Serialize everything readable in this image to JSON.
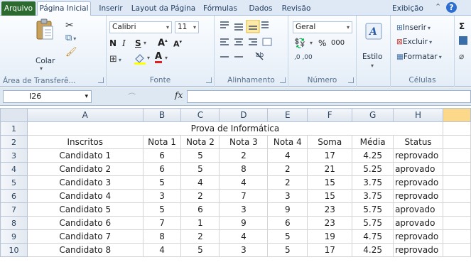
{
  "tabs": {
    "file": "Arquivo",
    "home": "Página Inicial",
    "insert": "Inserir",
    "layout": "Layout da Página",
    "formulas": "Fórmulas",
    "data": "Dados",
    "review": "Revisão",
    "view": "Exibição"
  },
  "ribbon": {
    "clipboard": {
      "paste": "Colar",
      "label": "Área de Transferê..."
    },
    "font": {
      "name": "Calibri",
      "size": "11",
      "bold": "N",
      "italic": "I",
      "underline": "S",
      "grow": "A",
      "shrink": "A",
      "color_letter": "A",
      "label": "Fonte"
    },
    "alignment": {
      "label": "Alinhamento"
    },
    "number": {
      "format": "Geral",
      "percent": "%",
      "thousands": "000",
      "inc_dec": ",0 ,00",
      "label": "Número"
    },
    "styles": {
      "button": "Estilo"
    },
    "cells": {
      "insert": "Inserir",
      "delete": "Excluir",
      "format": "Formatar",
      "label": "Células"
    },
    "sigma": "Σ"
  },
  "formula_bar": {
    "cell_ref": "I26",
    "fx": "fx",
    "content": ""
  },
  "sheet": {
    "columns": [
      "A",
      "B",
      "C",
      "D",
      "E",
      "F",
      "G",
      "H"
    ],
    "title": "Prova de Informática",
    "headers": [
      "Inscritos",
      "Nota 1",
      "Nota 2",
      "Nota 3",
      "Nota 4",
      "Soma",
      "Média",
      "Status"
    ],
    "rows": [
      {
        "n": "1"
      },
      {
        "n": "2"
      },
      {
        "n": "3",
        "cells": [
          "Candidato 1",
          "6",
          "5",
          "2",
          "4",
          "17",
          "4.25",
          "reprovado"
        ]
      },
      {
        "n": "4",
        "cells": [
          "Candidato 2",
          "6",
          "5",
          "8",
          "2",
          "21",
          "5.25",
          "aprovado"
        ]
      },
      {
        "n": "5",
        "cells": [
          "Candidato 3",
          "5",
          "4",
          "4",
          "2",
          "15",
          "3.75",
          "reprovado"
        ]
      },
      {
        "n": "6",
        "cells": [
          "Candidato 4",
          "3",
          "2",
          "7",
          "3",
          "15",
          "3.75",
          "reprovado"
        ]
      },
      {
        "n": "7",
        "cells": [
          "Candidato 5",
          "5",
          "6",
          "3",
          "9",
          "23",
          "5.75",
          "aprovado"
        ]
      },
      {
        "n": "8",
        "cells": [
          "Candidato 6",
          "7",
          "1",
          "9",
          "6",
          "23",
          "5.75",
          "aprovado"
        ]
      },
      {
        "n": "9",
        "cells": [
          "Candidato 7",
          "8",
          "2",
          "4",
          "5",
          "19",
          "4.75",
          "reprovado"
        ]
      },
      {
        "n": "10",
        "cells": [
          "Candidato 8",
          "4",
          "5",
          "3",
          "5",
          "17",
          "4.25",
          "reprovado"
        ]
      }
    ]
  },
  "colors": {
    "file_tab": "#2d6a2f",
    "selected_header": "#fbd88a",
    "grid_line": "#d4d4d4"
  }
}
